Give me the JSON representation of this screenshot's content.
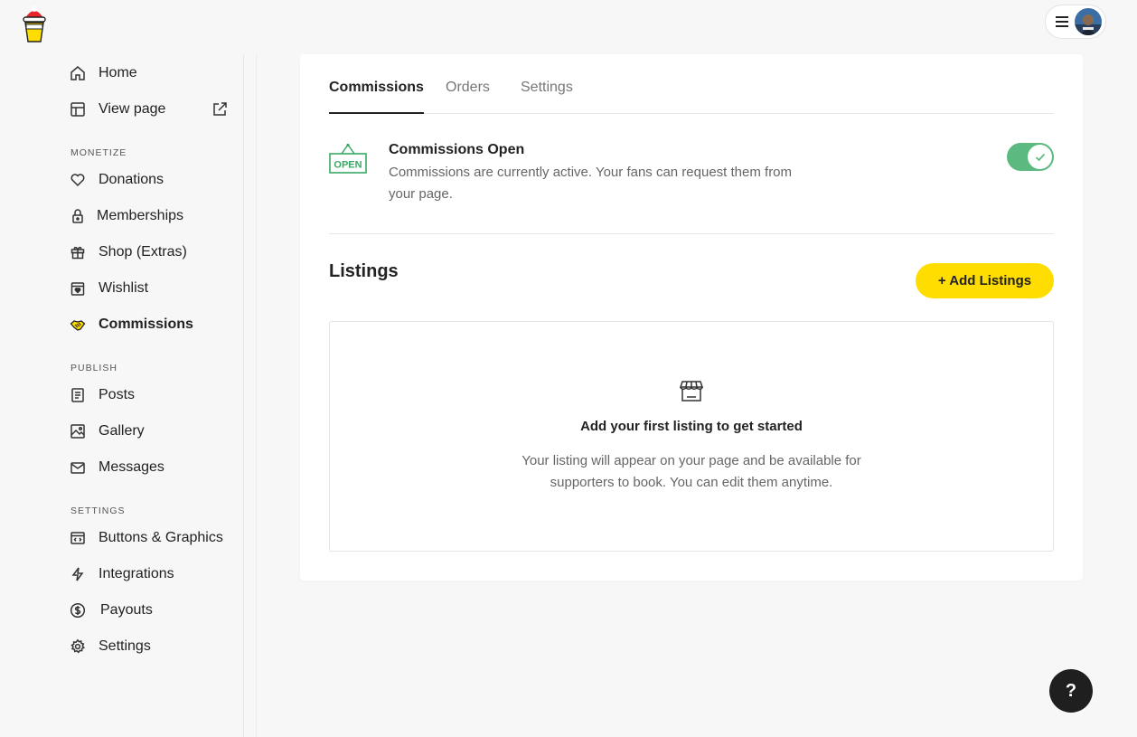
{
  "sidebar": {
    "items": [
      {
        "label": "Home",
        "icon": "home-icon"
      },
      {
        "label": "View page",
        "icon": "layout-icon"
      }
    ],
    "sections": [
      {
        "label": "MONETIZE",
        "items": [
          {
            "label": "Donations",
            "icon": "heart-icon"
          },
          {
            "label": "Memberships",
            "icon": "lock-icon"
          },
          {
            "label": "Shop (Extras)",
            "icon": "gift-icon"
          },
          {
            "label": "Wishlist",
            "icon": "wishlist-icon"
          },
          {
            "label": "Commissions",
            "icon": "handshake-icon",
            "active": true
          }
        ]
      },
      {
        "label": "PUBLISH",
        "items": [
          {
            "label": "Posts",
            "icon": "document-icon"
          },
          {
            "label": "Gallery",
            "icon": "image-icon"
          },
          {
            "label": "Messages",
            "icon": "mail-icon"
          }
        ]
      },
      {
        "label": "SETTINGS",
        "items": [
          {
            "label": "Buttons & Graphics",
            "icon": "code-window-icon"
          },
          {
            "label": "Integrations",
            "icon": "lightning-icon"
          },
          {
            "label": "Payouts",
            "icon": "dollar-icon"
          },
          {
            "label": "Settings",
            "icon": "gear-icon"
          }
        ]
      }
    ]
  },
  "tabs": [
    "Commissions",
    "Orders",
    "Settings"
  ],
  "commissions": {
    "sign_text": "OPEN",
    "title": "Commissions Open",
    "description": "Commissions are currently active. Your fans can request them from your page.",
    "enabled": true
  },
  "listings": {
    "title": "Listings",
    "add_button": "+ Add Listings",
    "empty_title": "Add your first listing to get started",
    "empty_description": "Your listing will appear on your page and be available for supporters to book. You can edit them anytime."
  },
  "help_label": "?",
  "colors": {
    "accent_yellow": "#ffdd00",
    "toggle_green": "#5cb97f",
    "open_sign_green": "#3aa865"
  }
}
